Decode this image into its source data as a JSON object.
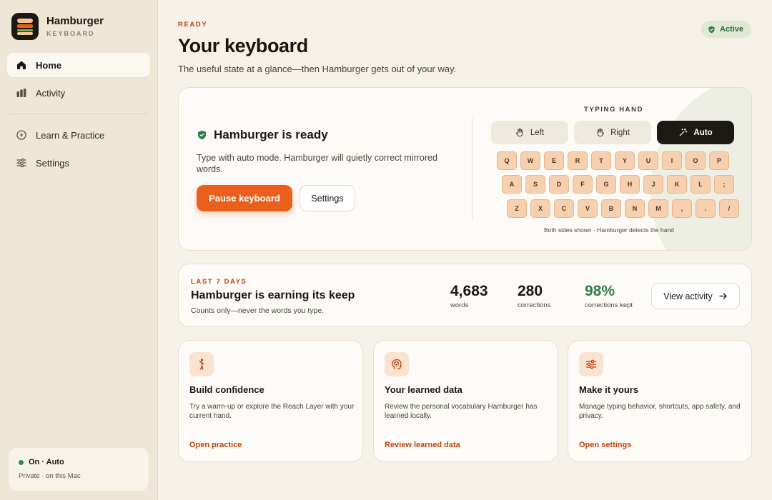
{
  "app": {
    "name": "Hamburger",
    "subtitle": "KEYBOARD"
  },
  "sidebar": {
    "items": [
      {
        "label": "Home",
        "icon": "home-icon",
        "active": true
      },
      {
        "label": "Activity",
        "icon": "bar-chart-icon"
      },
      {
        "label": "Learn & Practice",
        "icon": "bolt-icon"
      },
      {
        "label": "Settings",
        "icon": "sliders-icon"
      }
    ],
    "status": {
      "label": "On · Auto",
      "sub": "Private · on this Mac",
      "color": "#2f8a4f"
    }
  },
  "header": {
    "eyebrow": "READY",
    "title": "Your keyboard",
    "subtitle": "The useful state at a glance—then Hamburger gets out of your way.",
    "badge": "Active"
  },
  "hero": {
    "title": "Hamburger is ready",
    "description": "Type with auto mode. Hamburger will quietly correct mirrored words.",
    "primary_button": "Pause keyboard",
    "secondary_button": "Settings",
    "typing_hand_label": "TYPING HAND",
    "hand_options": [
      "Left",
      "Right",
      "Auto"
    ],
    "selected_hand": "Auto",
    "keyboard_rows": [
      [
        "Q",
        "W",
        "E",
        "R",
        "T",
        "Y",
        "U",
        "I",
        "O",
        "P"
      ],
      [
        "A",
        "S",
        "D",
        "F",
        "G",
        "H",
        "J",
        "K",
        "L",
        ";"
      ],
      [
        "Z",
        "X",
        "C",
        "V",
        "B",
        "N",
        "M",
        ",",
        ".",
        "/"
      ]
    ],
    "keyboard_note": "Both sides shown · Hamburger detects the hand"
  },
  "stats": {
    "eyebrow": "LAST 7 DAYS",
    "title": "Hamburger is earning its keep",
    "subtitle": "Counts only—never the words you type.",
    "items": [
      {
        "value": "4,683",
        "label": "words"
      },
      {
        "value": "280",
        "label": "corrections"
      },
      {
        "value": "98%",
        "label": "corrections kept"
      }
    ],
    "button": "View activity"
  },
  "features": [
    {
      "title": "Build confidence",
      "description": "Try a warm-up or explore the Reach Layer with your current hand.",
      "link": "Open practice",
      "icon": "person-icon"
    },
    {
      "title": "Your learned data",
      "description": "Review the personal vocabulary Hamburger has learned locally.",
      "link": "Review learned data",
      "icon": "brain-icon"
    },
    {
      "title": "Make it yours",
      "description": "Manage typing behavior, shortcuts, app safety, and privacy.",
      "link": "Open settings",
      "icon": "sliders-icon"
    }
  ],
  "colors": {
    "accent": "#ea5f1c",
    "accent_text": "#c2410c",
    "success": "#2f7d48",
    "key_fill": "#f7d0b0"
  }
}
